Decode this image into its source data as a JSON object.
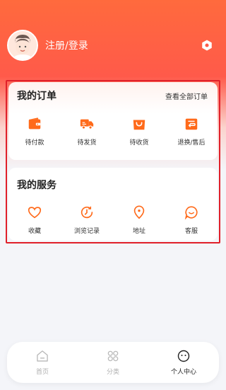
{
  "profile": {
    "login_text": "注册/登录",
    "avatar_icon": "user-avatar-icon"
  },
  "settings": {
    "icon": "hexagon-settings-icon"
  },
  "orders": {
    "title": "我的订单",
    "view_all": "查看全部订单",
    "items": [
      {
        "label": "待付款",
        "icon": "wallet-icon"
      },
      {
        "label": "待发货",
        "icon": "truck-icon"
      },
      {
        "label": "待收货",
        "icon": "shopping-bag-icon"
      },
      {
        "label": "退换/售后",
        "icon": "return-icon"
      }
    ]
  },
  "services": {
    "title": "我的服务",
    "items": [
      {
        "label": "收藏",
        "icon": "heart-icon"
      },
      {
        "label": "浏览记录",
        "icon": "history-clock-icon"
      },
      {
        "label": "地址",
        "icon": "location-pin-icon"
      },
      {
        "label": "客服",
        "icon": "chat-support-icon"
      }
    ]
  },
  "tabbar": {
    "items": [
      {
        "label": "首页",
        "icon": "home-icon",
        "active": false
      },
      {
        "label": "分类",
        "icon": "category-icon",
        "active": false
      },
      {
        "label": "个人中心",
        "icon": "smiley-profile-icon",
        "active": true
      }
    ]
  },
  "colors": {
    "accent": "#ff6a1a",
    "header_start": "#ff6a3d",
    "highlight_frame": "#e0202a",
    "inactive_tab": "#b0b0b0"
  }
}
